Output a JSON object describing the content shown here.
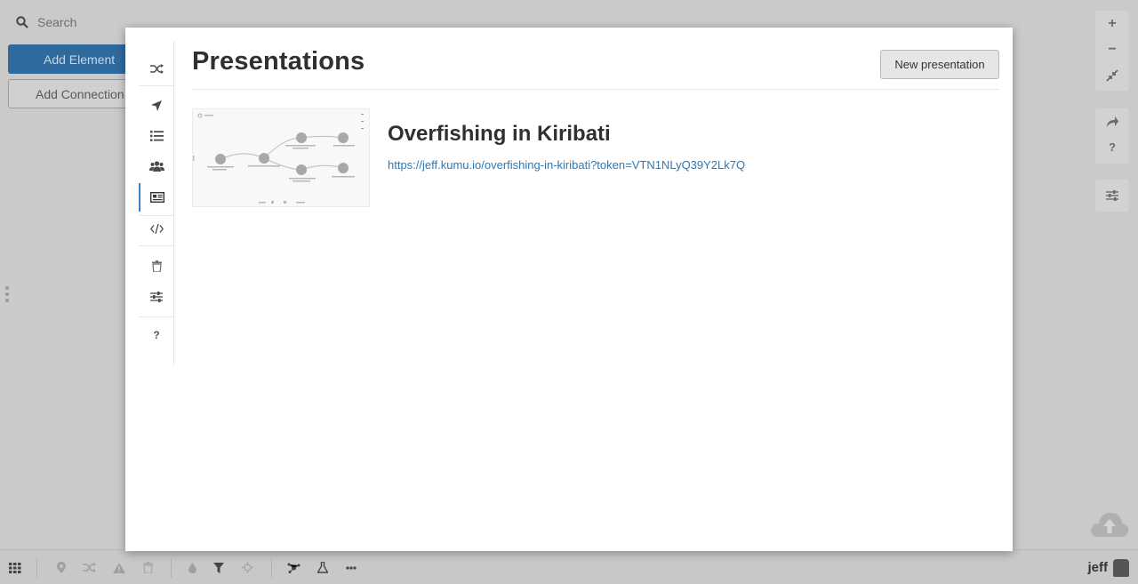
{
  "background": {
    "search_placeholder": "Search",
    "add_element_label": "Add Element",
    "add_connection_label": "Add Connection",
    "user_name": "jeff"
  },
  "right_toolbar": {
    "zoom_in": "+",
    "zoom_out": "−",
    "help": "?"
  },
  "modal": {
    "title": "Presentations",
    "new_button_label": "New presentation",
    "nav_icons": [
      "shuffle-icon",
      "navigation-arrow-icon",
      "list-icon",
      "people-icon",
      "presentation-icon",
      "code-icon",
      "trash-icon",
      "sliders-icon",
      "help-icon"
    ],
    "help_label": "?",
    "presentations": [
      {
        "title": "Overfishing in Kiribati",
        "url": "https://jeff.kumu.io/overfishing-in-kiribati?token=VTN1NLyQ39Y2Lk7Q"
      }
    ]
  },
  "colors": {
    "accent": "#3b82c4",
    "link": "#2a7ab8",
    "primary_button": "#2f6a9f"
  }
}
